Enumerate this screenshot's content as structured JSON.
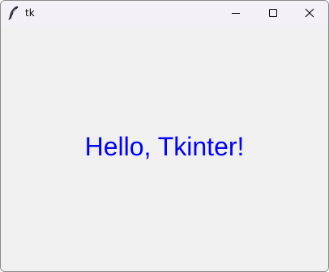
{
  "window": {
    "title": "tk",
    "app_icon": "feather-icon",
    "controls": {
      "minimize_icon": "minimize-icon",
      "maximize_icon": "maximize-icon",
      "close_icon": "close-icon"
    }
  },
  "main": {
    "label_text": "Hello, Tkinter!",
    "label_color": "#0000ff",
    "background_color": "#f0f0f0"
  }
}
